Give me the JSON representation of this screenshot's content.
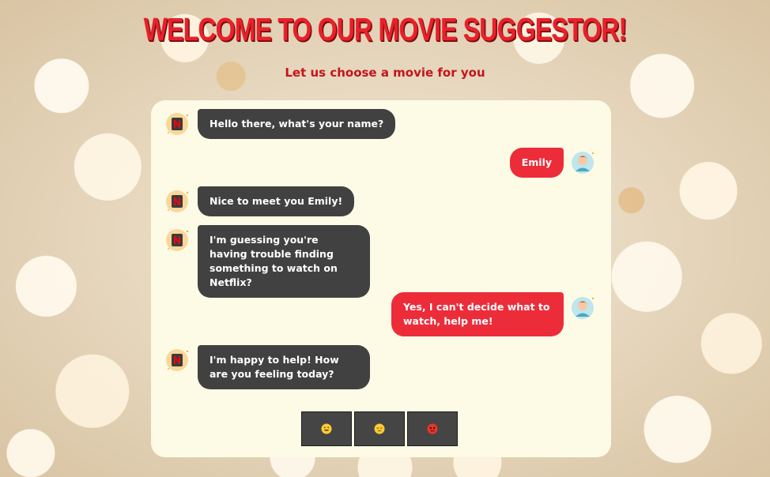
{
  "header": {
    "title": "WELCOME TO OUR MOVIE SUGGESTOR!",
    "subtitle": "Let us choose a movie for you"
  },
  "chat": {
    "messages": [
      {
        "sender": "bot",
        "text": "Hello there, what's your name?"
      },
      {
        "sender": "user",
        "text": "Emily"
      },
      {
        "sender": "bot",
        "text": "Nice to meet you Emily!"
      },
      {
        "sender": "bot",
        "text": "I'm guessing you're having trouble finding something to watch on Netflix?"
      },
      {
        "sender": "user",
        "text": "Yes, I can't decide what to watch, help me!"
      },
      {
        "sender": "bot",
        "text": "I'm happy to help! How are you feeling today?"
      }
    ],
    "options": [
      {
        "icon": "grinning-face-icon",
        "label": "😀"
      },
      {
        "icon": "sad-face-icon",
        "label": "😔"
      },
      {
        "icon": "angry-face-icon",
        "label": "😡"
      }
    ]
  },
  "colors": {
    "accent": "#e8212a",
    "bot_bubble": "#414141",
    "user_bubble": "#ed2c3a",
    "panel": "#fdfbe6"
  }
}
